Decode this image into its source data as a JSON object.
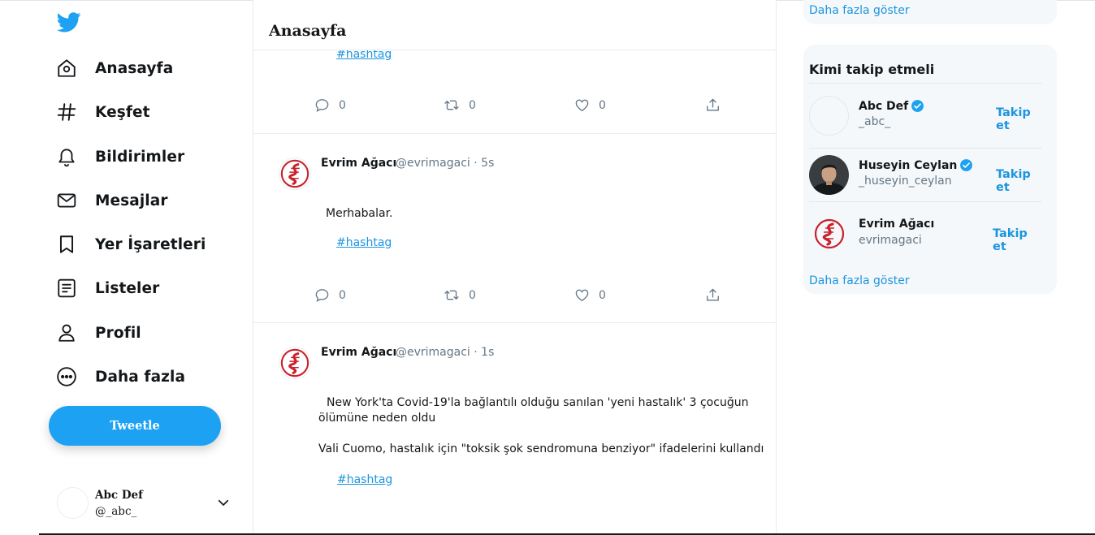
{
  "sidebar": {
    "logo_icon": "twitter-bird-icon",
    "items": [
      {
        "label": "Anasayfa",
        "icon": "home-icon"
      },
      {
        "label": "Keşfet",
        "icon": "hashtag-icon"
      },
      {
        "label": "Bildirimler",
        "icon": "bell-icon"
      },
      {
        "label": "Mesajlar",
        "icon": "envelope-icon"
      },
      {
        "label": "Yer İşaretleri",
        "icon": "bookmark-icon"
      },
      {
        "label": "Listeler",
        "icon": "list-icon"
      },
      {
        "label": "Profil",
        "icon": "person-icon"
      },
      {
        "label": "Daha fazla",
        "icon": "more-circle-icon"
      }
    ],
    "tweet_button": "Tweetle",
    "account": {
      "name": "Abc Def",
      "handle": "@_abc_"
    }
  },
  "main": {
    "title": "Anasayfa",
    "tweets": [
      {
        "hashtag": "#hashtag",
        "replies": "0",
        "retweets": "0",
        "likes": "0"
      },
      {
        "name": "Evrim Ağacı",
        "meta": "@evrimagaci · 5s",
        "text": "Merhabalar.",
        "hashtag": "#hashtag",
        "replies": "0",
        "retweets": "0",
        "likes": "0"
      },
      {
        "name": "Evrim Ağacı",
        "meta": "@evrimagaci · 1s",
        "text_line1": "New York'ta Covid-19'la bağlantılı olduğu sanılan 'yeni hastalık' 3 çocuğun",
        "text_line2": "ölümüne neden oldu",
        "text_line3": "Vali Cuomo, hastalık için \"toksik şok sendromuna benziyor\" ifadelerini kullandı",
        "hashtag": "#hashtag"
      }
    ]
  },
  "right": {
    "top_more": "Daha fazla göster",
    "who_to_follow": {
      "title": "Kimi takip etmeli",
      "users": [
        {
          "name": "Abc Def",
          "handle": "_abc_",
          "verified": true,
          "follow": "Takip et"
        },
        {
          "name": "Huseyin Ceylan",
          "handle": "_huseyin_ceylan",
          "verified": true,
          "follow": "Takip et"
        },
        {
          "name": "Evrim Ağacı",
          "handle": "evrimagaci",
          "verified": false,
          "follow": "Takip et"
        }
      ],
      "more": "Daha fazla göster"
    }
  },
  "colors": {
    "accent": "#1da1f2",
    "link": "#1b95e0",
    "muted": "#657786",
    "panel": "#f5f8fa",
    "logo_red": "#c8202c"
  }
}
